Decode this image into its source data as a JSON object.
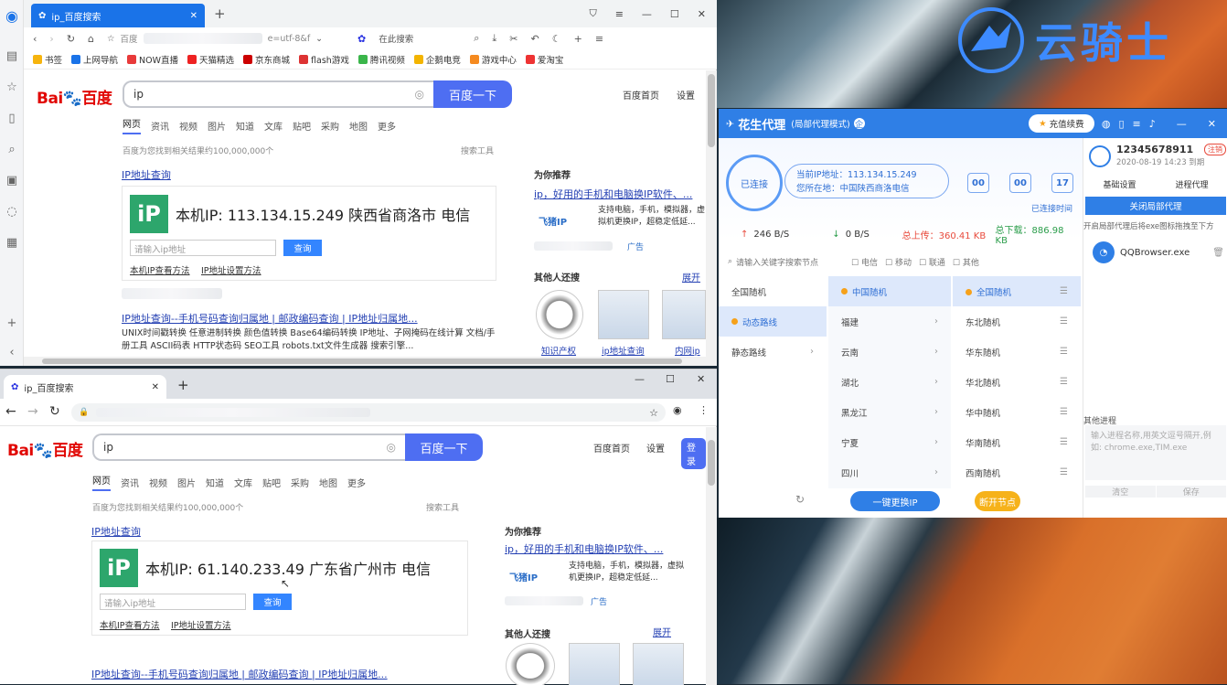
{
  "wallpaper": {
    "brand_text": "云骑士"
  },
  "win1": {
    "tab_title": "ip_百度搜索",
    "address_partial": "e=utf-8&f",
    "address_prefix": "百度",
    "search_in_page": "在此搜索",
    "bookmarks": [
      "书签",
      "上网导航",
      "NOW直播",
      "天猫精选",
      "京东商城",
      "flash游戏",
      "腾讯视频",
      "企鹅电竞",
      "游戏中心",
      "爱淘宝"
    ],
    "baidu": {
      "logo_a": "Bai",
      "logo_b": "百度",
      "query": "ip",
      "search_btn": "百度一下",
      "links": [
        "百度首页",
        "设置"
      ],
      "tabs": [
        "网页",
        "资讯",
        "视频",
        "图片",
        "知道",
        "文库",
        "贴吧",
        "采购",
        "地图",
        "更多"
      ],
      "result_count": "百度为您找到相关结果约100,000,000个",
      "search_tools": "搜索工具",
      "result1_title": "IP地址查询",
      "my_ip_label": "本机IP: 113.134.15.249  陕西省商洛市 电信",
      "ip_input_placeholder": "请输入ip地址",
      "query_btn": "查询",
      "ip_links": [
        "本机IP查看方法",
        "IP地址设置方法"
      ],
      "result2_title": "IP地址查询--手机号码查询归属地 | 邮政编码查询 | IP地址归属地...",
      "result2_desc": "UNIX时间戳转换 任意进制转换 颜色值转换 Base64编码转换 IP地址、子网掩码在线计算 文档/手册工具 ASCII码表 HTTP状态码 SEO工具 robots.txt文件生成器 搜索引擎...",
      "rec_heading": "为你推荐",
      "rec_title": "ip，好用的手机和电脑换IP软件、...",
      "rec_desc": "支持电脑，手机，模拟器，虚拟机更换IP，超稳定低延...",
      "rec_logo": "飞猪IP",
      "ad_label": "广告",
      "others_heading": "其他人还搜",
      "expand": "展开",
      "thumb_labels": [
        "知识产权",
        "ip地址查询",
        "内网ip"
      ]
    }
  },
  "win2": {
    "tab_title": "ip_百度搜索",
    "baidu": {
      "logo_a": "Bai",
      "logo_b": "百度",
      "query": "ip",
      "search_btn": "百度一下",
      "links": [
        "百度首页",
        "设置",
        "登录"
      ],
      "tabs": [
        "网页",
        "资讯",
        "视频",
        "图片",
        "知道",
        "文库",
        "贴吧",
        "采购",
        "地图",
        "更多"
      ],
      "result_count": "百度为您找到相关结果约100,000,000个",
      "search_tools": "搜索工具",
      "result1_title": "IP地址查询",
      "my_ip_label": "本机IP: 61.140.233.49  广东省广州市 电信",
      "ip_input_placeholder": "请输入ip地址",
      "query_btn": "查询",
      "ip_links": [
        "本机IP查看方法",
        "IP地址设置方法"
      ],
      "result2_title": "IP地址查询--手机号码查询归属地 | 邮政编码查询 | IP地址归属地...",
      "rec_heading": "为你推荐",
      "rec_title": "ip，好用的手机和电脑换IP软件、...",
      "rec_desc": "支持电脑，手机，模拟器，虚拟机更换IP，超稳定低延...",
      "rec_logo": "飞猪IP",
      "ad_label": "广告",
      "others_heading": "其他人还搜",
      "expand": "展开"
    }
  },
  "proxy": {
    "app_name": "花生代理",
    "mode": "(局部代理模式)",
    "recharge": "充值续费",
    "status": "已连接",
    "current_ip": "当前IP地址：113.134.15.249",
    "location": "您所在地：中国陕西商洛电信",
    "timer": [
      "00",
      "00",
      "17"
    ],
    "connected_time": "已连接时间",
    "speed_up": "246 B/S",
    "speed_down": "0 B/S",
    "total_up": "总上传：360.41 KB",
    "total_down": "总下载：886.98 KB",
    "account": "12345678911",
    "logout": "注销",
    "expire": "2020-08-19 14:23 到期",
    "side_tabs": [
      "基础设置",
      "进程代理"
    ],
    "close_btn": "关闭局部代理",
    "hint": "开启局部代理后将exe图标拖拽至下方",
    "process": "QQBrowser.exe",
    "other_process": "其他进程",
    "process_placeholder": "输入进程名称,用英文逗号隔开,例如: chrome.exe,TIM.exe",
    "clear": "清空",
    "save": "保存",
    "search_placeholder": "请输入关键字搜索节点",
    "filters": [
      "电信",
      "移动",
      "联通",
      "其他"
    ],
    "col1": [
      "全国随机",
      "动态路线",
      "静态路线"
    ],
    "col2": [
      "中国随机",
      "福建",
      "云南",
      "湖北",
      "黑龙江",
      "宁夏",
      "四川"
    ],
    "col3": [
      "全国随机",
      "东北随机",
      "华东随机",
      "华北随机",
      "华中随机",
      "华南随机",
      "西南随机"
    ],
    "change_ip": "一键更换IP",
    "disconnect": "断开节点"
  }
}
